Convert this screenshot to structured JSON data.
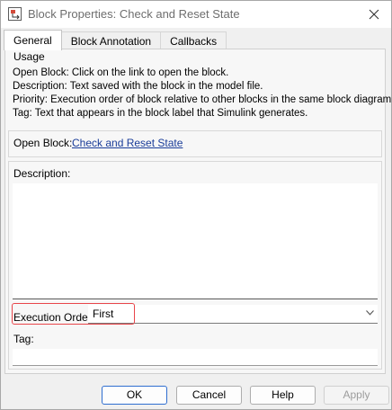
{
  "window": {
    "title": "Block Properties: Check and Reset State",
    "app_icon": "block-properties-icon",
    "close_icon": "close-icon"
  },
  "tabs": [
    {
      "label": "General",
      "active": true
    },
    {
      "label": "Block Annotation",
      "active": false
    },
    {
      "label": "Callbacks",
      "active": false
    }
  ],
  "usage": {
    "legend": "Usage",
    "lines": [
      "Open Block: Click on the link to open the block.",
      "Description: Text saved with the block in the model file.",
      "Priority: Execution order of block relative to other blocks in the same block diagram.",
      "Tag: Text that appears in the block label that Simulink generates."
    ]
  },
  "open_block": {
    "label": "Open Block:",
    "link_text": "Check and Reset State",
    "link_color": "#1a3d99"
  },
  "description": {
    "label": "Description:",
    "value": ""
  },
  "execution_order": {
    "label": "Execution Order:",
    "selected": "First",
    "chevron_icon": "chevron-down-icon",
    "highlight_color": "#e8454a"
  },
  "tag": {
    "label": "Tag:",
    "value": ""
  },
  "buttons": {
    "ok": "OK",
    "cancel": "Cancel",
    "help": "Help",
    "apply": "Apply",
    "apply_disabled": true,
    "default_border_color": "#2f6ed0"
  }
}
